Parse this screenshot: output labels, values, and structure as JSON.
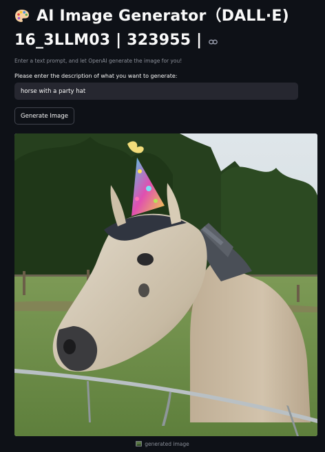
{
  "header": {
    "title_line1": "AI Image Generator（DALL·E)",
    "title_line2": "16_3LLM03 | 323955 |",
    "palette_icon": "artist-palette-icon",
    "link_icon": "link-icon"
  },
  "intro": {
    "subtitle": "Enter a text prompt, and let OpenAI generate the image for you!"
  },
  "form": {
    "prompt_label": "Please enter the description of what you want to generate:",
    "prompt_value": "horse with a party hat",
    "generate_button_label": "Generate Image"
  },
  "result": {
    "image_alt": "generated image",
    "caption": "generated image",
    "caption_icon": "broken-image-icon"
  },
  "colors": {
    "background": "#0e1117",
    "input_background": "#262730",
    "text": "#fafafa",
    "muted_text": "#8b8f99"
  }
}
